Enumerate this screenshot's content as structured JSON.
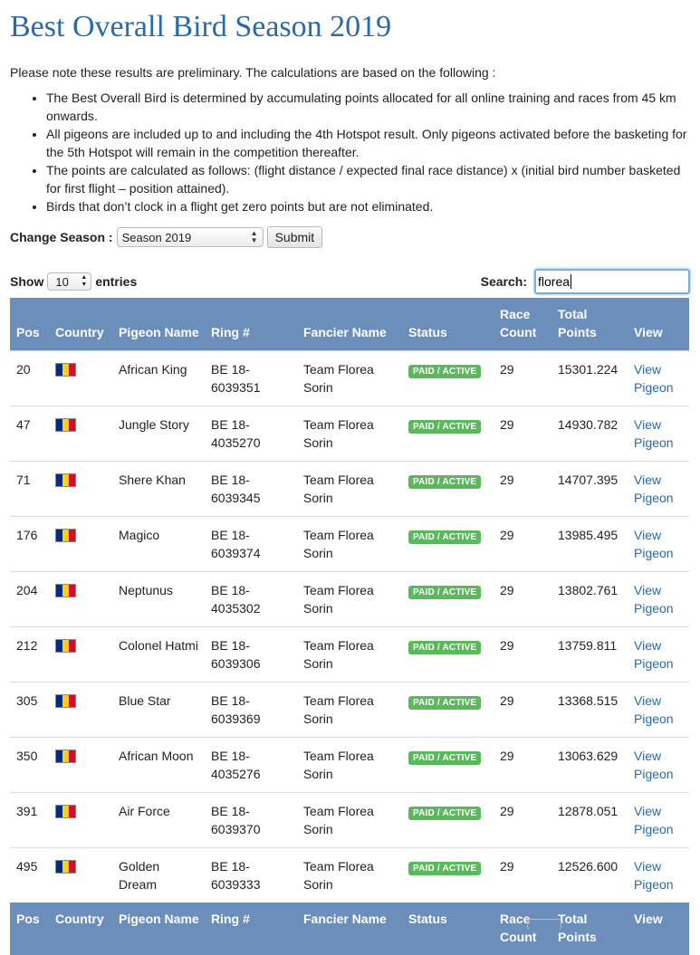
{
  "page": {
    "title": "Best Overall Bird Season 2019",
    "intro": "Please note these results are preliminary. The calculations are based on the following :",
    "notes": [
      "The Best Overall Bird is determined by accumulating points allocated for all online training and races from 45 km onwards.",
      "All pigeons are included up to and including the 4th Hotspot result. Only pigeons activated before the basketing for the 5th Hotspot will remain in the competition thereafter.",
      "The points are calculated as follows: (flight distance / expected final race distance) x (initial bird number basketed for first flight – position attained).",
      "Birds that don’t clock in a flight get zero points but are not eliminated."
    ]
  },
  "season_form": {
    "label": "Change Season :",
    "selected": "Season 2019",
    "submit_label": "Submit"
  },
  "table_controls": {
    "show_label": "Show",
    "entries_value": "10",
    "entries_label": "entries",
    "search_label": "Search:",
    "search_value": "florea"
  },
  "table": {
    "columns": [
      "Pos",
      "Country",
      "Pigeon Name",
      "Ring #",
      "Fancier Name",
      "Status",
      "Race Count",
      "Total Points",
      "View"
    ],
    "rows": [
      {
        "pos": "20",
        "name": "African King",
        "ring": "BE 18-6039351",
        "fancier": "Team Florea Sorin",
        "status": "PAID / ACTIVE",
        "races": "29",
        "points": "15301.224",
        "view": "View Pigeon"
      },
      {
        "pos": "47",
        "name": "Jungle Story",
        "ring": "BE 18-4035270",
        "fancier": "Team Florea Sorin",
        "status": "PAID / ACTIVE",
        "races": "29",
        "points": "14930.782",
        "view": "View Pigeon"
      },
      {
        "pos": "71",
        "name": "Shere Khan",
        "ring": "BE 18-6039345",
        "fancier": "Team Florea Sorin",
        "status": "PAID / ACTIVE",
        "races": "29",
        "points": "14707.395",
        "view": "View Pigeon"
      },
      {
        "pos": "176",
        "name": "Magico",
        "ring": "BE 18-6039374",
        "fancier": "Team Florea Sorin",
        "status": "PAID / ACTIVE",
        "races": "29",
        "points": "13985.495",
        "view": "View Pigeon"
      },
      {
        "pos": "204",
        "name": "Neptunus",
        "ring": "BE 18-4035302",
        "fancier": "Team Florea Sorin",
        "status": "PAID / ACTIVE",
        "races": "29",
        "points": "13802.761",
        "view": "View Pigeon"
      },
      {
        "pos": "212",
        "name": "Colonel Hatmi",
        "ring": "BE 18-6039306",
        "fancier": "Team Florea Sorin",
        "status": "PAID / ACTIVE",
        "races": "29",
        "points": "13759.811",
        "view": "View Pigeon"
      },
      {
        "pos": "305",
        "name": "Blue Star",
        "ring": "BE 18-6039369",
        "fancier": "Team Florea Sorin",
        "status": "PAID / ACTIVE",
        "races": "29",
        "points": "13368.515",
        "view": "View Pigeon"
      },
      {
        "pos": "350",
        "name": "African Moon",
        "ring": "BE 18-4035276",
        "fancier": "Team Florea Sorin",
        "status": "PAID / ACTIVE",
        "races": "29",
        "points": "13063.629",
        "view": "View Pigeon"
      },
      {
        "pos": "391",
        "name": "Air Force",
        "ring": "BE 18-6039370",
        "fancier": "Team Florea Sorin",
        "status": "PAID / ACTIVE",
        "races": "29",
        "points": "12878.051",
        "view": "View Pigeon"
      },
      {
        "pos": "495",
        "name": "Golden Dream",
        "ring": "BE 18-6039333",
        "fancier": "Team Florea Sorin",
        "status": "PAID / ACTIVE",
        "races": "29",
        "points": "12526.600",
        "view": "View Pigeon"
      }
    ]
  },
  "colors": {
    "title": "#2a6aa8",
    "header_bg": "#6b8ebb",
    "badge_green": "#5cb85c",
    "link": "#2a6aa8",
    "flag": [
      "#002b7f",
      "#fcd116",
      "#ce1126"
    ]
  },
  "icons": {
    "country_flag": "romania-flag-icon",
    "select_arrows": "updown-arrows-icon"
  }
}
